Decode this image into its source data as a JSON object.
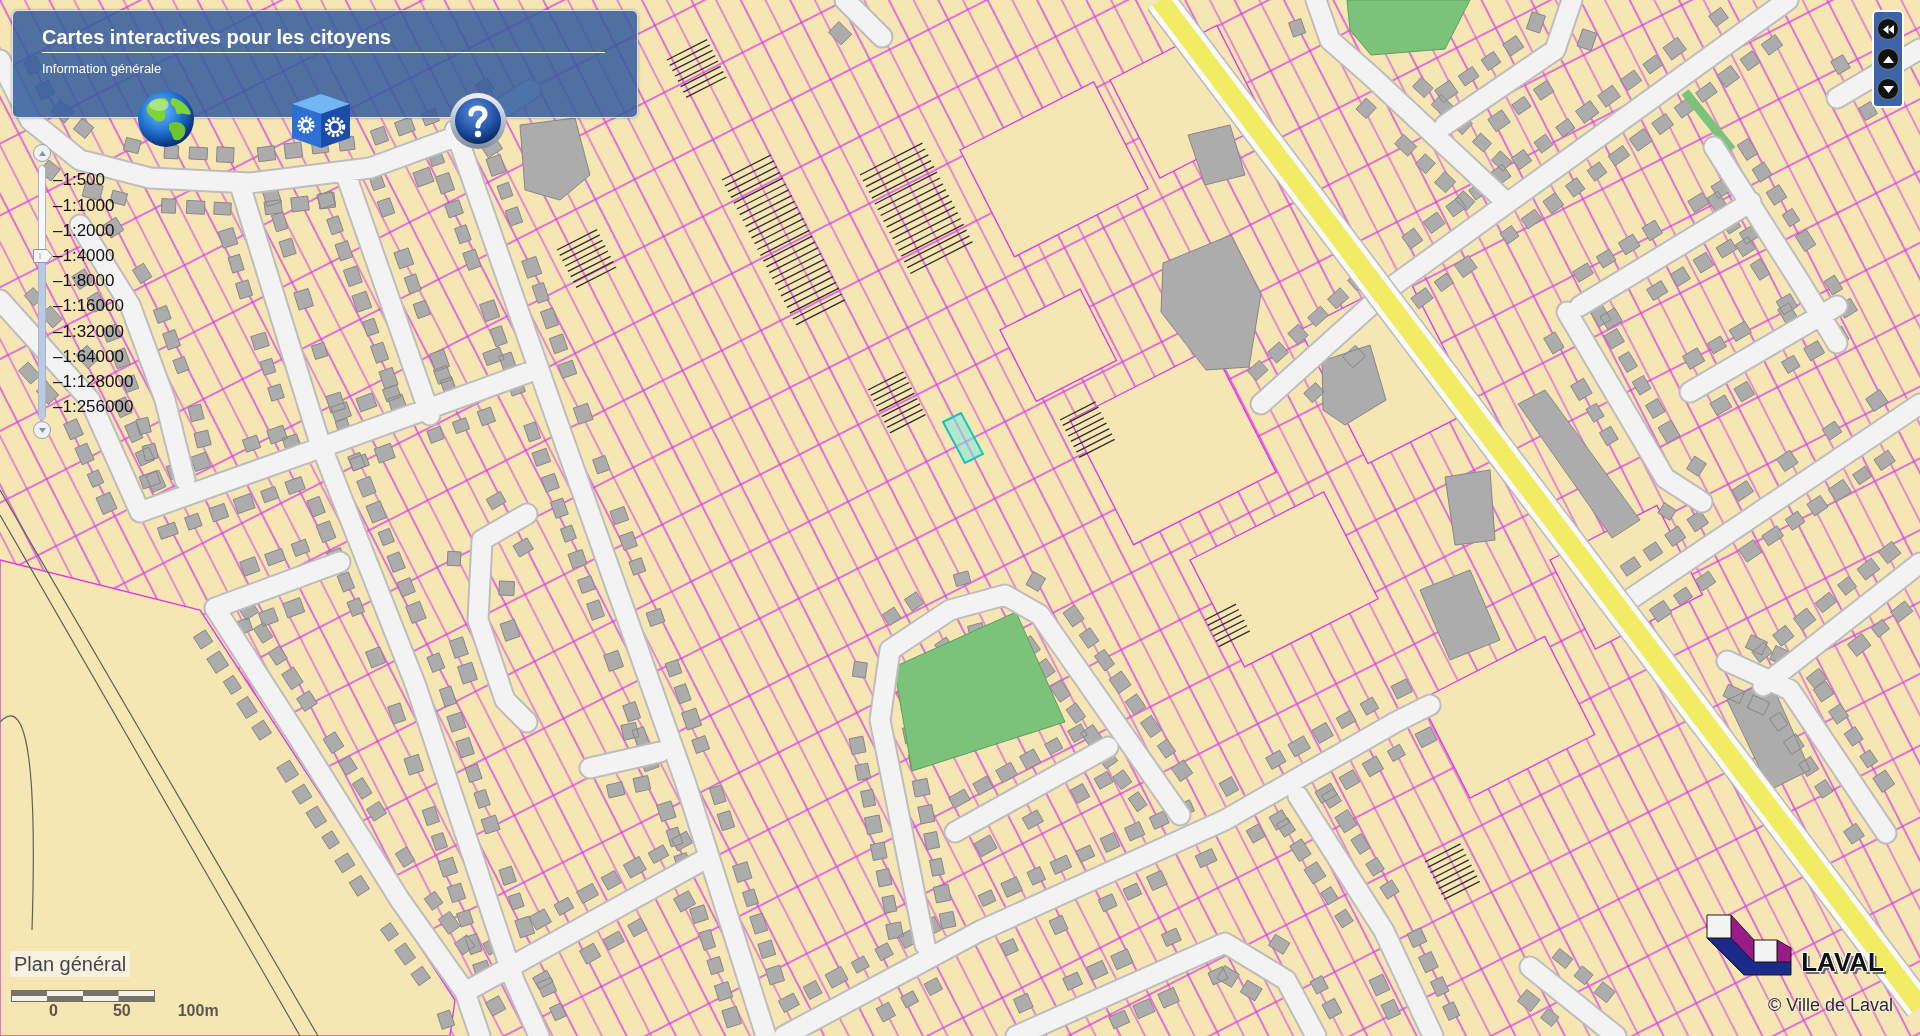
{
  "header": {
    "title": "Cartes interactives pour les citoyens",
    "subtitle": "Information générale"
  },
  "zoom_scale": {
    "scales": [
      {
        "label": "–1:500",
        "selected": false
      },
      {
        "label": "–1:1000",
        "selected": false
      },
      {
        "label": "–1:2000",
        "selected": false
      },
      {
        "label": "–1:4000",
        "selected": true
      },
      {
        "label": "–1:8000",
        "selected": false
      },
      {
        "label": "–1:16000",
        "selected": false
      },
      {
        "label": "–1:32000",
        "selected": false
      },
      {
        "label": "–1:64000",
        "selected": false
      },
      {
        "label": "–1:128000",
        "selected": false
      },
      {
        "label": "–1:256000",
        "selected": false
      }
    ]
  },
  "layer_label": "Plan général",
  "scale_bar": {
    "labels": [
      "0",
      "50",
      "100m"
    ]
  },
  "logo": {
    "text": "LAVAL"
  },
  "copyright": "© Ville de Laval"
}
